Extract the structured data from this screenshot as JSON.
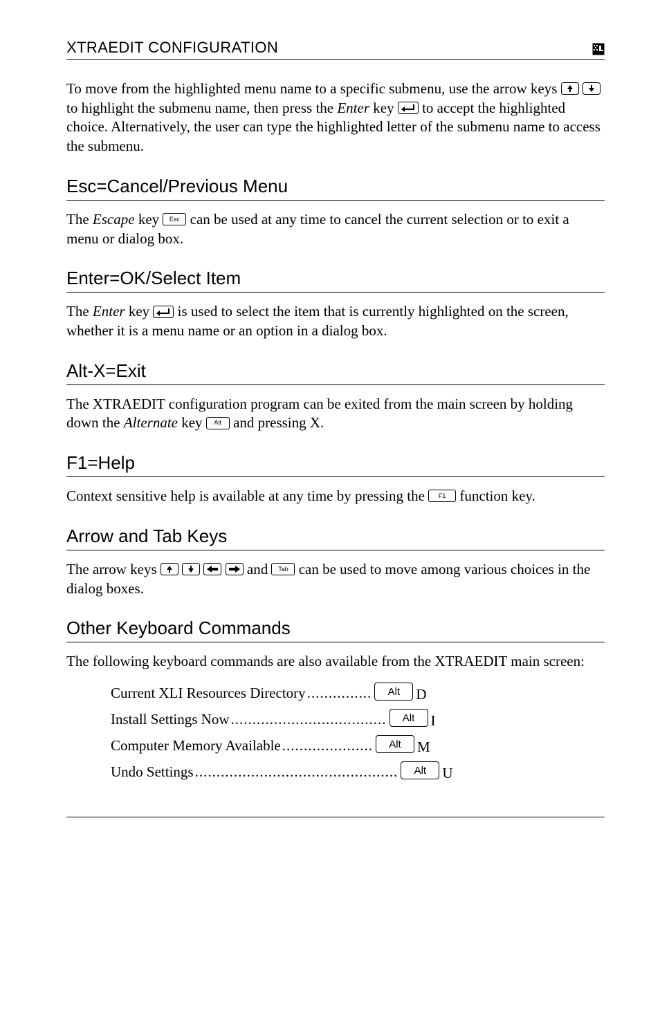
{
  "header": {
    "running_title": "XTRAEDIT CONFIGURATION"
  },
  "intro_para_pieces": {
    "a": "To move from the highlighted menu name to a specific submenu, use the arrow keys ",
    "b": " to highlight the submenu name, then press the ",
    "c": "Enter",
    "d": " key ",
    "e": " to accept the highlighted choice. Alternatively, the user can type the highlighted letter of the submenu name to access the submenu."
  },
  "esc": {
    "head": "Esc=Cancel/Previous Menu",
    "p1a": "The ",
    "p1b": "Escape",
    "p1c": " key ",
    "p1d": " can be used at any time to cancel the current selection or to exit a menu or dialog box."
  },
  "enter": {
    "head": "Enter=OK/Select Item",
    "p1a": "The ",
    "p1b": "Enter",
    "p1c": " key ",
    "p1d": " is used to select the item that is currently highlighted on the screen, whether it is a menu name or an option in a dialog box."
  },
  "altx": {
    "head": "Alt-X=Exit",
    "p1a": "The XTRAEDIT configuration program can be exited from the main screen by holding down the ",
    "p1b": "Alternate",
    "p1c": " key ",
    "p1d": " and pressing X."
  },
  "f1": {
    "head": "F1=Help",
    "p1a": "Context sensitive help is available at any time by pressing the ",
    "p1b": " function key."
  },
  "arrows": {
    "head": "Arrow and Tab Keys",
    "p1a": "The arrow keys ",
    "p1b": " and ",
    "p1c": " can be used to move among various choices in the dialog boxes."
  },
  "other": {
    "head": "Other Keyboard Commands",
    "intro": "The following keyboard commands are also available from the XTRAEDIT main screen:",
    "items": [
      {
        "label": "Current XLI Resources Directory",
        "dots": " ............... ",
        "mod": "Alt",
        "letter": "D"
      },
      {
        "label": "Install Settings Now",
        "dots": " .................................... ",
        "mod": "Alt",
        "letter": "I"
      },
      {
        "label": "Computer Memory Available",
        "dots": " ..................... ",
        "mod": "Alt",
        "letter": "M"
      },
      {
        "label": "Undo Settings",
        "dots": "............................................... ",
        "mod": "Alt",
        "letter": "U"
      }
    ]
  },
  "keycap_labels": {
    "esc": "Esc",
    "alt": "Alt",
    "f1": "F1",
    "tab": "Tab"
  }
}
